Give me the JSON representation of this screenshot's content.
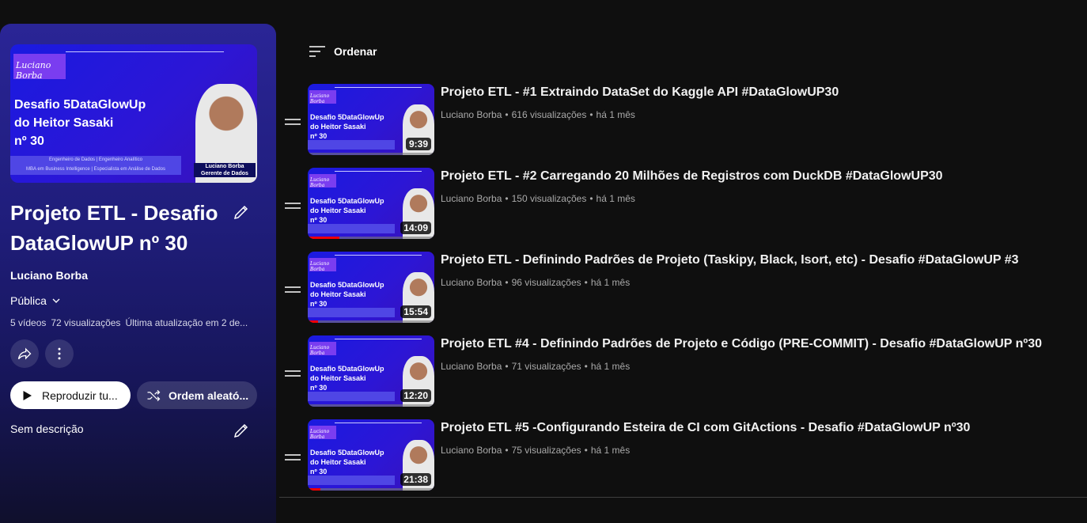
{
  "playlist": {
    "title": "Projeto ETL - Desafio DataGlowUP nº 30",
    "owner": "Luciano Borba",
    "privacy": "Pública",
    "video_count": "5 vídeos",
    "views": "72 visualizações",
    "updated": "Última atualização em 2 de...",
    "play_label": "Reproduzir tu...",
    "shuffle_label": "Ordem aleató...",
    "description": "Sem descrição",
    "thumbnail": {
      "logo": "Luciano Borba",
      "headline_1": "Desafio 5DataGlowUp",
      "headline_2": "do Heitor Sasaki",
      "headline_3": "nº 30",
      "band_1": "Engenheiro de Dados | Engenheiro Analítico",
      "band_2": "MBA em Business Intelligence | Especialista em Análise de Dados",
      "name_1": "Luciano Borba",
      "name_2": "Gerente de Dados"
    }
  },
  "sort_label": "Ordenar",
  "videos": [
    {
      "title": "Projeto ETL - #1 Extraindo DataSet do Kaggle API #DataGlowUP30",
      "channel": "Luciano Borba",
      "views": "616 visualizações",
      "age": "há 1 mês",
      "duration": "9:39",
      "watched": 0.0
    },
    {
      "title": "Projeto ETL - #2 Carregando 20 Milhões de Registros com DuckDB #DataGlowUP30",
      "channel": "Luciano Borba",
      "views": "150 visualizações",
      "age": "há 1 mês",
      "duration": "14:09",
      "watched": 0.25
    },
    {
      "title": "Projeto ETL - Definindo Padrões de Projeto (Taskipy, Black, Isort, etc) - Desafio #DataGlowUP #3",
      "channel": "Luciano Borba",
      "views": "96 visualizações",
      "age": "há 1 mês",
      "duration": "15:54",
      "watched": 0.08
    },
    {
      "title": "Projeto ETL #4 - Definindo Padrões de Projeto e Código (PRE-COMMIT) - Desafio #DataGlowUP nº30",
      "channel": "Luciano Borba",
      "views": "71 visualizações",
      "age": "há 1 mês",
      "duration": "12:20",
      "watched": 0.0
    },
    {
      "title": "Projeto ETL #5 -Configurando Esteira de CI com GitActions - Desafio #DataGlowUP nº30",
      "channel": "Luciano Borba",
      "views": "75 visualizações",
      "age": "há 1 mês",
      "duration": "21:38",
      "watched": 0.1
    }
  ],
  "video_thumb": {
    "logo": "Luciano Borba",
    "headline_1": "Desafio 5DataGlowUp",
    "headline_2": "do Heitor Sasaki",
    "headline_3": "nº 30"
  },
  "colors": {
    "accent_progress": "#ee0000",
    "panel_top": "#2a2596",
    "background": "#0f0f0f"
  },
  "icons": [
    "edit-pencil-icon",
    "chevron-down-icon",
    "share-icon",
    "more-vert-icon",
    "play-icon",
    "shuffle-icon",
    "sort-icon",
    "drag-handle-icon"
  ]
}
